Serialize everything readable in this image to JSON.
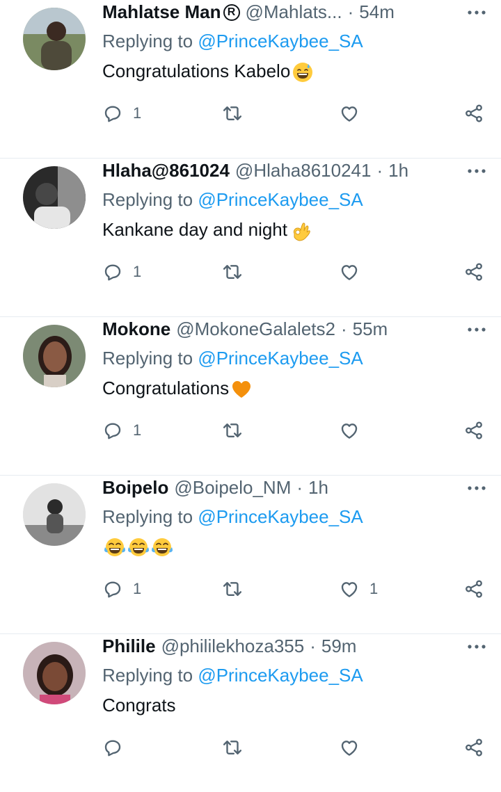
{
  "tweets": [
    {
      "name": "Mahlatse Man",
      "badge": "R",
      "handle": "@Mahlats...",
      "time": "54m",
      "reply_prefix": "Replying to",
      "reply_to": "@PrinceKaybee_SA",
      "text": "Congratulations Kabelo",
      "emojis": [
        "grinning-sweat-emoji"
      ],
      "reply_count": "1",
      "retweet_count": "",
      "like_count": ""
    },
    {
      "name": "Hlaha@861024",
      "badge": "",
      "handle": "@Hlaha8610241",
      "time": "1h",
      "reply_prefix": "Replying to",
      "reply_to": "@PrinceKaybee_SA",
      "text": "Kankane day and night",
      "emojis": [
        "ok-hand-emoji"
      ],
      "reply_count": "1",
      "retweet_count": "",
      "like_count": ""
    },
    {
      "name": "Mokone",
      "badge": "",
      "handle": "@MokoneGalalets2",
      "time": "55m",
      "reply_prefix": "Replying to",
      "reply_to": "@PrinceKaybee_SA",
      "text": "Congratulations ",
      "emojis": [
        "orange-heart-emoji"
      ],
      "reply_count": "1",
      "retweet_count": "",
      "like_count": ""
    },
    {
      "name": "Boipelo",
      "badge": "",
      "handle": "@Boipelo_NM",
      "time": "1h",
      "reply_prefix": "Replying to",
      "reply_to": "@PrinceKaybee_SA",
      "text": "",
      "emojis": [
        "tears-of-joy-emoji",
        "tears-of-joy-emoji",
        "tears-of-joy-emoji"
      ],
      "reply_count": "1",
      "retweet_count": "",
      "like_count": "1"
    },
    {
      "name": "Philile",
      "badge": "",
      "handle": "@phililekhoza355",
      "time": "59m",
      "reply_prefix": "Replying to",
      "reply_to": "@PrinceKaybee_SA",
      "text": "Congrats",
      "emojis": [],
      "reply_count": "",
      "retweet_count": "",
      "like_count": ""
    }
  ],
  "separator": "·",
  "colors": {
    "accent": "#1d9bf0",
    "muted": "#536471",
    "text": "#0f1419",
    "divider": "#e6ecf0"
  },
  "icons": [
    "more-icon",
    "reply-icon",
    "retweet-icon",
    "like-icon",
    "share-icon"
  ]
}
